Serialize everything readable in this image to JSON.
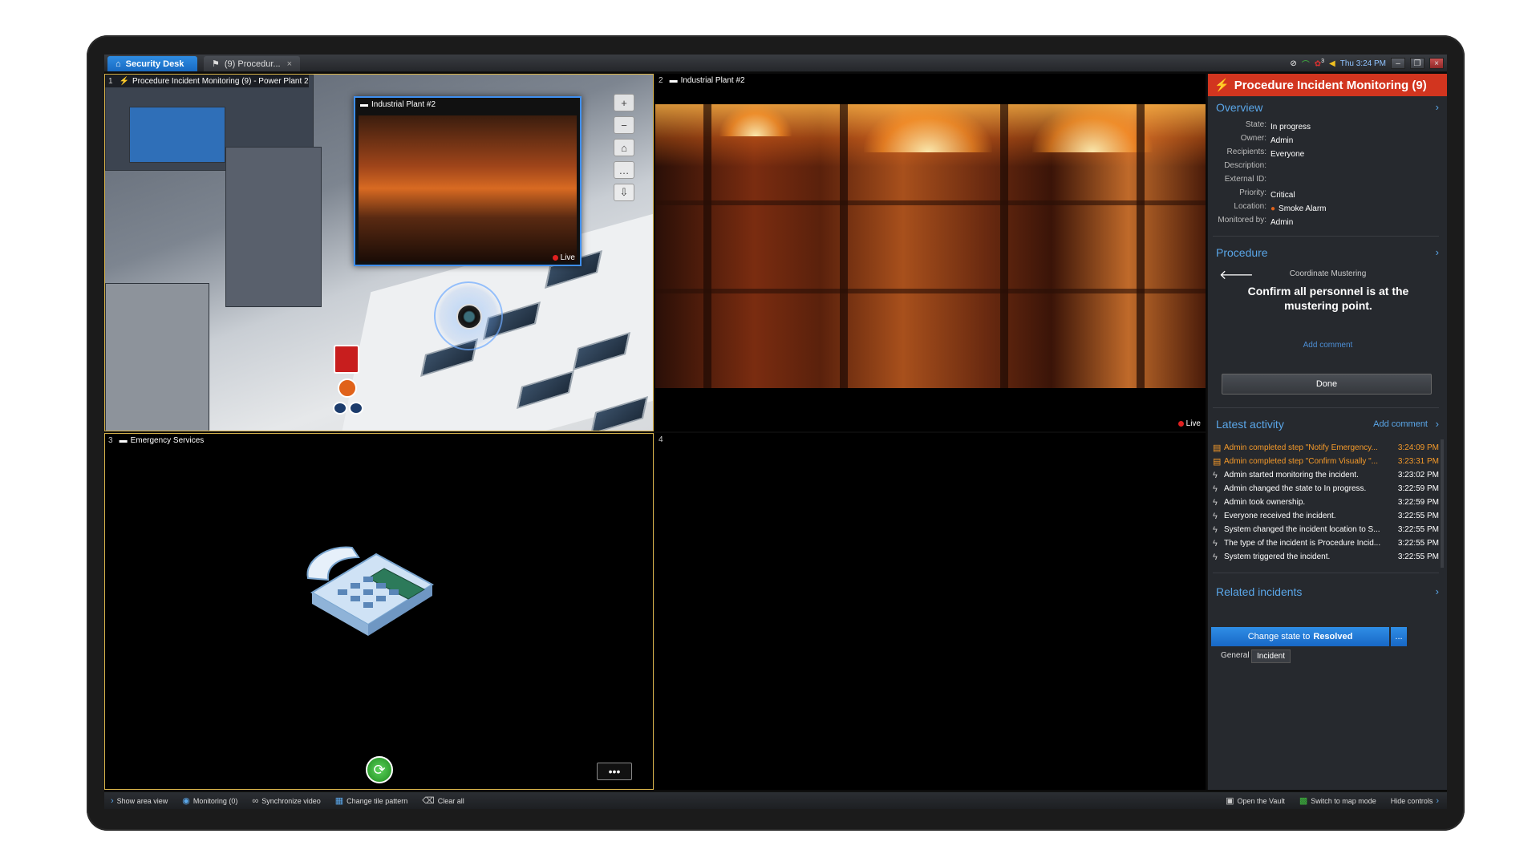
{
  "tabs": [
    {
      "label": "Security Desk",
      "icon": "home-icon"
    },
    {
      "label": "(9) Procedur...",
      "icon": "incident-icon"
    }
  ],
  "system": {
    "clock": "Thu 3:24 PM",
    "notification_count": "3"
  },
  "tiles": {
    "t1": {
      "num": "1",
      "title": "Procedure Incident Monitoring (9) - Power Plant 2",
      "popup_title": "Industrial Plant #2",
      "popup_live": "Live"
    },
    "t2": {
      "num": "2",
      "title": "Industrial Plant #2",
      "live": "Live"
    },
    "t3": {
      "num": "3",
      "title": "Emergency Services",
      "more": "•••"
    },
    "t4": {
      "num": "4"
    }
  },
  "panel": {
    "title": "Procedure Incident Monitoring (9)",
    "overview": {
      "heading": "Overview",
      "fields": [
        {
          "k": "State:",
          "v": "In progress"
        },
        {
          "k": "Owner:",
          "v": "Admin"
        },
        {
          "k": "Recipients:",
          "v": "Everyone"
        },
        {
          "k": "Description:",
          "v": ""
        },
        {
          "k": "External ID:",
          "v": ""
        },
        {
          "k": "Priority:",
          "v": "Critical"
        },
        {
          "k": "Location:",
          "v": "Smoke Alarm"
        },
        {
          "k": "Monitored by:",
          "v": "Admin"
        }
      ]
    },
    "procedure": {
      "heading": "Procedure",
      "step": "Coordinate Mustering",
      "message": "Confirm all personnel is at the mustering point.",
      "add_comment": "Add comment",
      "done": "Done"
    },
    "activity": {
      "heading": "Latest activity",
      "add_comment": "Add comment",
      "rows": [
        {
          "text": "Admin completed step \"Notify Emergency...",
          "time": "3:24:09 PM",
          "orange": true
        },
        {
          "text": "Admin completed step \"Confirm Visually \"...",
          "time": "3:23:31 PM",
          "orange": true
        },
        {
          "text": "Admin started monitoring the incident.",
          "time": "3:23:02 PM"
        },
        {
          "text": "Admin changed the state to In progress.",
          "time": "3:22:59 PM"
        },
        {
          "text": "Admin took ownership.",
          "time": "3:22:59 PM"
        },
        {
          "text": "Everyone received the incident.",
          "time": "3:22:55 PM"
        },
        {
          "text": "System changed the incident location to S...",
          "time": "3:22:55 PM"
        },
        {
          "text": "The type of the incident is Procedure Incid...",
          "time": "3:22:55 PM"
        },
        {
          "text": "System triggered the incident.",
          "time": "3:22:55 PM"
        }
      ]
    },
    "related": {
      "heading": "Related incidents"
    },
    "state_button": {
      "prefix": "Change state to",
      "state": "Resolved",
      "more": "..."
    },
    "tabs": [
      "General",
      "Incident"
    ]
  },
  "bottombar": {
    "left": [
      {
        "label": "Show area view",
        "icon": "chevron-right-icon"
      },
      {
        "label": "Monitoring (0)",
        "icon": "monitoring-icon"
      },
      {
        "label": "Synchronize video",
        "icon": "link-icon"
      },
      {
        "label": "Change tile pattern",
        "icon": "tile-pattern-icon"
      },
      {
        "label": "Clear all",
        "icon": "clear-icon"
      }
    ],
    "right": [
      {
        "label": "Open the Vault",
        "icon": "vault-icon"
      },
      {
        "label": "Switch to map mode",
        "icon": "map-icon"
      },
      {
        "label": "Hide controls",
        "icon": "chevron-right-icon"
      }
    ]
  },
  "colors": {
    "accent": "#1f7ad6",
    "header_red": "#d2351f",
    "activity_orange": "#f59a2a",
    "tile_border": "#d8b34a"
  }
}
